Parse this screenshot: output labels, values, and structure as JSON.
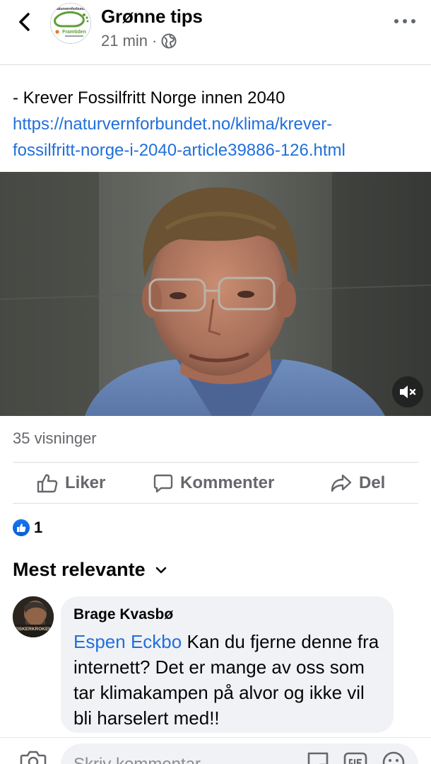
{
  "header": {
    "page_name": "Grønne tips",
    "time": "21 min",
    "separator": "·",
    "avatar_text_top": "Naturvernforbundet",
    "avatar_text_bottom": "Framtiden"
  },
  "post": {
    "text": "- Krever Fossilfritt Norge innen 2040",
    "link_line1": "https://naturvernforbundet.no/klima/krever-",
    "link_line2": "fossilfritt-norge-i-2040-article39886-126.html"
  },
  "stats": {
    "views": "35 visninger",
    "like_count": "1"
  },
  "actions": {
    "like": "Liker",
    "comment": "Kommenter",
    "share": "Del"
  },
  "comments": {
    "sort_label": "Mest relevante",
    "items": [
      {
        "author": "Brage Kvasbø",
        "mention": "Espen Eckbo",
        "text": " Kan du fjerne denne fra internett? Det er mange av oss som tar klimakampen på alvor og ikke vil bli harselert med!!",
        "avatar_caption": "FISKERKROKEN"
      }
    ]
  },
  "composer": {
    "placeholder": "Skriv kommentar..."
  },
  "colors": {
    "link": "#216fdb",
    "secondary_text": "#65676b",
    "like_blue": "#1877f2"
  }
}
